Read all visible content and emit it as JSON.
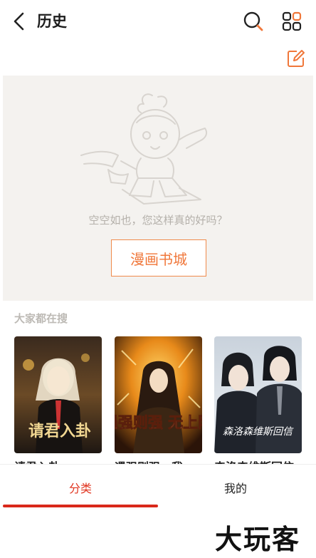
{
  "header": {
    "title": "历史",
    "back_icon": "chevron-left-icon",
    "search_icon": "search-icon",
    "grid_icon": "grid-icon",
    "edit_icon": "edit-icon",
    "accent_color": "#f0773a"
  },
  "empty_state": {
    "message": "空空如也，您这样真的好吗？",
    "button_label": "漫画书城"
  },
  "popular": {
    "section_title": "大家都在搜",
    "items": [
      {
        "title": "请君入卦",
        "cover_text": "请君入卦"
      },
      {
        "title": "遇强则强，我",
        "cover_text": "遇强则强 无上限"
      },
      {
        "title": "森洛森维斯回信",
        "cover_text": "森洛森维斯回信"
      }
    ]
  },
  "bottom_nav": {
    "tabs": [
      {
        "label": "分类",
        "active": true
      },
      {
        "label": "我的",
        "active": false
      }
    ],
    "active_color": "#d9281a"
  },
  "watermark": "大玩客"
}
